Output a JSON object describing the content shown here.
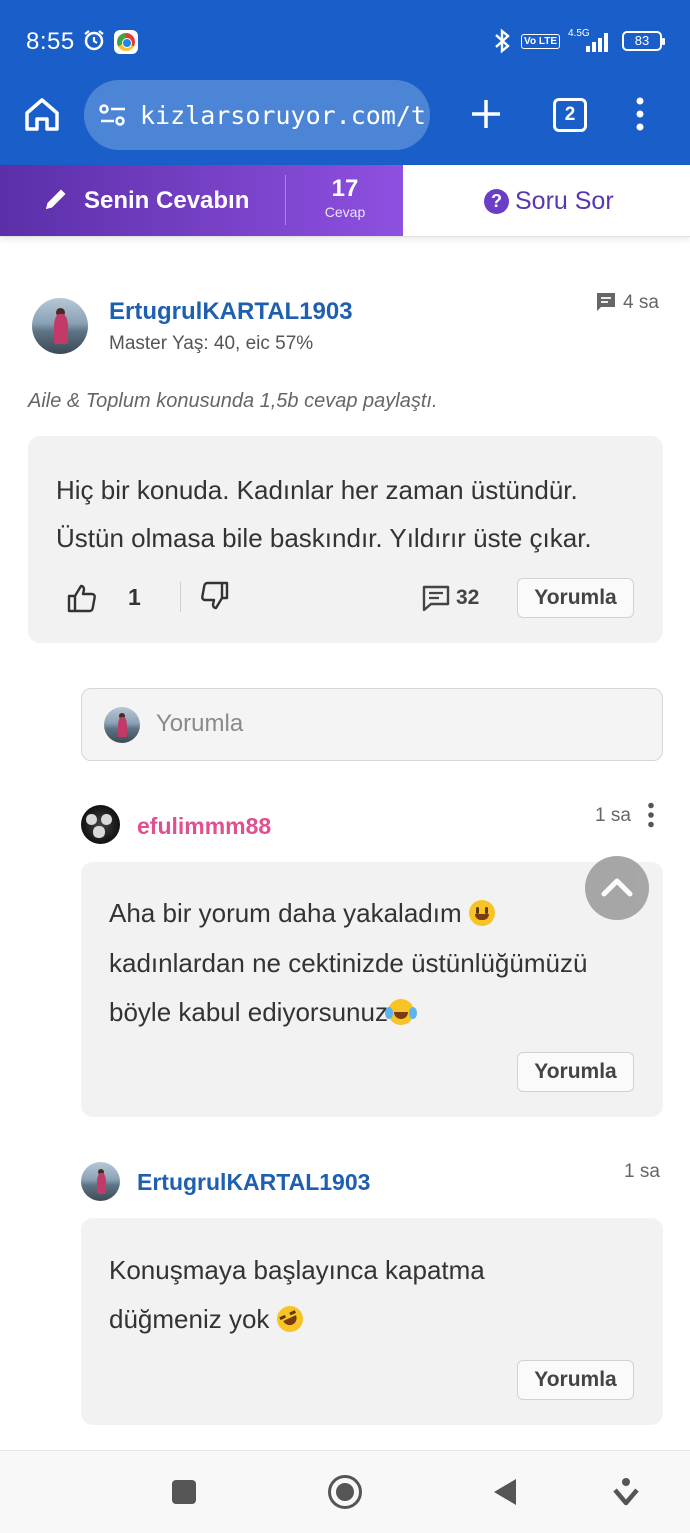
{
  "status_bar": {
    "time": "8:55",
    "network": "4.5G",
    "volte": "Vo LTE",
    "battery": "83"
  },
  "browser": {
    "url": "kizlarsoruyor.com/t",
    "tab_count": "2"
  },
  "answer_bar": {
    "your_answer_label": "Senin Cevabın",
    "answer_count": "17",
    "answer_count_label": "Cevap",
    "ask_label": "Soru Sor",
    "accent_color": "#6a3fc6"
  },
  "answer": {
    "username": "ErtugrulKARTAL1903",
    "meta": "Master Yaş: 40, eic 57%",
    "time": "4 sa",
    "note": "Aile & Toplum konusunda 1,5b cevap paylaştı.",
    "text_line1": "Hiç bir konuda. Kadınlar her zaman üstündür.",
    "text_line2": "Üstün olmasa bile baskındır. Yıldırır üste çıkar.",
    "likes": "1",
    "comment_count": "32",
    "comment_button": "Yorumla"
  },
  "comment_input": {
    "placeholder": "Yorumla"
  },
  "comments": [
    {
      "username": "efulimmm88",
      "time": "1 sa",
      "line1": "Aha bir yorum daha yakaladım",
      "line2": "kadınlardan ne cektinizde üstünlüğümüzü",
      "line3": "böyle kabul ediyorsunuz",
      "button": "Yorumla",
      "name_color": "#e0508f"
    },
    {
      "username": "ErtugrulKARTAL1903",
      "time": "1 sa",
      "line1": "Konuşmaya başlayınca kapatma",
      "line2": "düğmeniz yok",
      "button": "Yorumla",
      "name_color": "#1f5fb0"
    }
  ]
}
